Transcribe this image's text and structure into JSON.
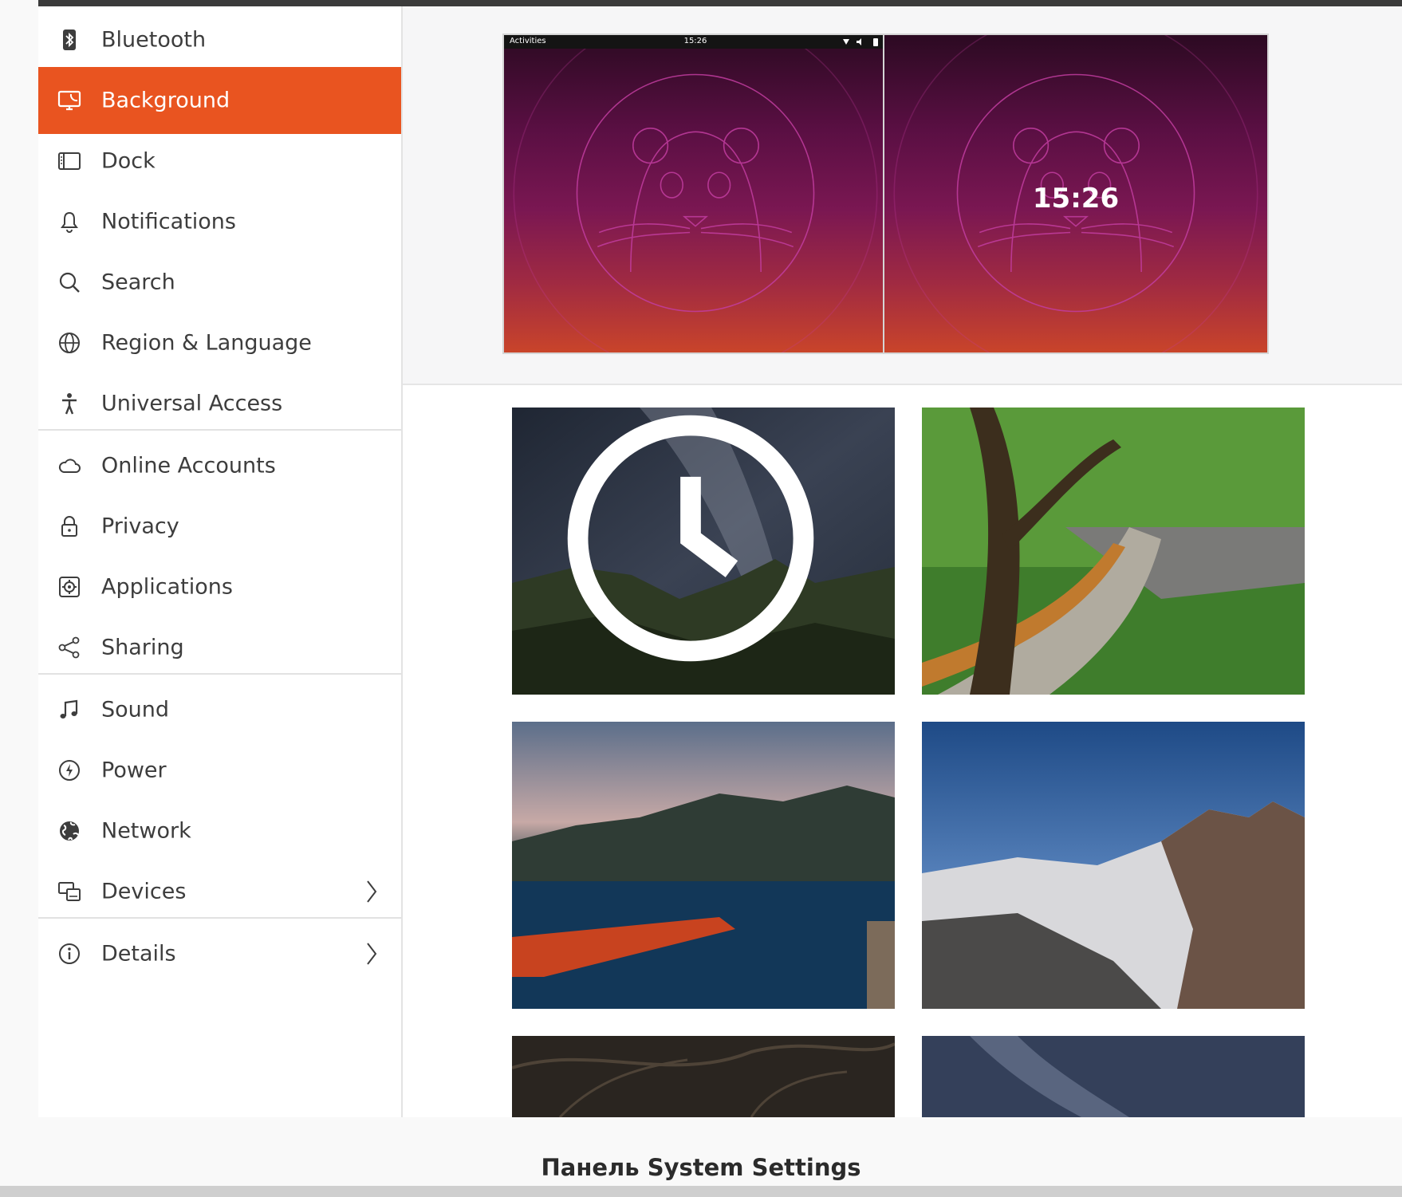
{
  "sidebar": {
    "items": [
      {
        "label": "Bluetooth",
        "icon": "bluetooth-icon"
      },
      {
        "label": "Background",
        "icon": "background-icon",
        "active": true
      },
      {
        "label": "Dock",
        "icon": "dock-icon"
      },
      {
        "label": "Notifications",
        "icon": "bell-icon"
      },
      {
        "label": "Search",
        "icon": "search-icon"
      },
      {
        "label": "Region & Language",
        "icon": "globe-icon"
      },
      {
        "label": "Universal Access",
        "icon": "accessibility-icon"
      },
      {
        "label": "Online Accounts",
        "icon": "cloud-icon"
      },
      {
        "label": "Privacy",
        "icon": "lock-icon"
      },
      {
        "label": "Applications",
        "icon": "applications-icon"
      },
      {
        "label": "Sharing",
        "icon": "share-icon"
      },
      {
        "label": "Sound",
        "icon": "music-note-icon"
      },
      {
        "label": "Power",
        "icon": "power-icon"
      },
      {
        "label": "Network",
        "icon": "network-globe-icon"
      },
      {
        "label": "Devices",
        "icon": "devices-icon",
        "has_submenu": true
      },
      {
        "label": "Details",
        "icon": "info-icon",
        "has_submenu": true
      }
    ]
  },
  "previews": {
    "desktop": {
      "panel_left": "Activities",
      "panel_time": "15:26"
    },
    "lock_screen": {
      "clock": "15:26"
    }
  },
  "wallpapers": [
    {
      "name": "milky-way-mountains",
      "slideshow": true
    },
    {
      "name": "great-wall-path"
    },
    {
      "name": "lake-boat"
    },
    {
      "name": "snowy-mountains"
    },
    {
      "name": "night-branches"
    },
    {
      "name": "night-sky"
    }
  ],
  "colors": {
    "accent": "#e95420",
    "text": "#3d3d3d"
  },
  "caption": "Панель System Settings"
}
